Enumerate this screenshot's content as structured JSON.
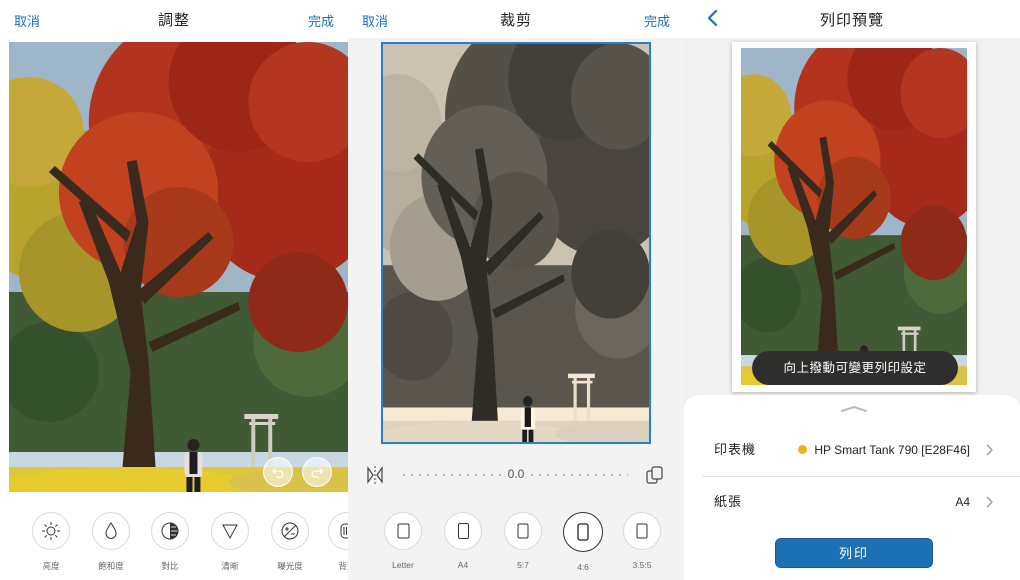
{
  "adjust": {
    "cancel": "取消",
    "title": "調整",
    "done": "完成",
    "tools": [
      {
        "label": "亮度",
        "icon": "sun-icon"
      },
      {
        "label": "飽和度",
        "icon": "droplet-icon"
      },
      {
        "label": "對比",
        "icon": "contrast-icon"
      },
      {
        "label": "清晰",
        "icon": "triangle-icon"
      },
      {
        "label": "曝光度",
        "icon": "exposure-icon"
      },
      {
        "label": "背形",
        "icon": "vignette-icon"
      }
    ]
  },
  "crop": {
    "cancel": "取消",
    "title": "裁剪",
    "done": "完成",
    "rotation_value": "0.0",
    "aspect_options": [
      {
        "label": "Letter",
        "selected": false
      },
      {
        "label": "A4",
        "selected": false
      },
      {
        "label": "5:7",
        "selected": false
      },
      {
        "label": "4:6",
        "selected": true
      },
      {
        "label": "3.5:5",
        "selected": false
      }
    ]
  },
  "preview": {
    "title": "列印預覽",
    "tooltip": "向上撥動可變更列印設定",
    "printer_label": "印表機",
    "printer_value": "HP Smart Tank 790 [E28F46]",
    "printer_status_color": "#f2b01e",
    "paper_label": "紙張",
    "paper_value": "A4",
    "print_button": "列印"
  },
  "colors": {
    "accent": "#1e70b5",
    "crop_frame": "#2b7fc2"
  }
}
